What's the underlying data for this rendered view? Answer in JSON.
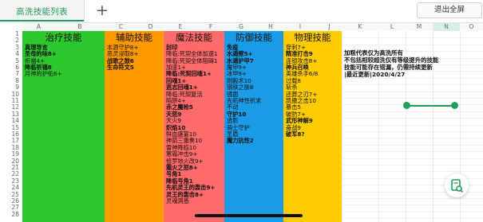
{
  "toolbar": {
    "tab_label": "高洗技能列表",
    "add_label": "+",
    "exit_label": "退出全屏"
  },
  "columns": [
    "A",
    "B",
    "C",
    "D",
    "E",
    "F",
    "G",
    "H",
    "I",
    "J",
    "K",
    "L",
    "M",
    "N",
    "O"
  ],
  "rows": [
    "1",
    "2",
    "3",
    "4",
    "5",
    "6",
    "7",
    "8",
    "9",
    "10",
    "11",
    "12",
    "13",
    "14",
    "15",
    "16",
    "17",
    "18",
    "19",
    "20",
    "21",
    "22",
    "23",
    "24",
    "25",
    "26",
    "27",
    "28"
  ],
  "categories": [
    {
      "title": "治疗技能",
      "color": "#2ec72e",
      "items": [
        {
          "t": "真理导言",
          "b": true
        },
        {
          "t": "圣母的味8+",
          "b": true
        },
        {
          "t": "祈福4+",
          "b": false
        },
        {
          "t": "降临祈福8",
          "b": true
        },
        {
          "t": "月神的护佑6+",
          "b": false
        }
      ]
    },
    {
      "title": "辅助技能",
      "color": "#ff9900",
      "items": [
        {
          "t": "本源守护8+",
          "b": false
        },
        {
          "t": "恶灵浸取8+",
          "b": false
        },
        {
          "t": "战歌之鼓6",
          "b": true
        },
        {
          "t": "生命符文5",
          "b": true
        }
      ]
    },
    {
      "title": "魔法技能",
      "color": "#ff6b6b",
      "items": [
        {
          "t": "封印",
          "b": true
        },
        {
          "t": "降临:死契全体加速1",
          "b": false
        },
        {
          "t": "降临:死契全体阻碍1",
          "b": false
        },
        {
          "t": "加速1+",
          "b": false
        },
        {
          "t": "降临:死契回魂1+",
          "b": true
        },
        {
          "t": "回魂1+",
          "b": true
        },
        {
          "t": "逃志回魂1+",
          "b": true
        },
        {
          "t": "降临:死契复活",
          "b": false
        },
        {
          "t": "陷阱4+",
          "b": false
        },
        {
          "t": "赤之魔枪5",
          "b": true
        },
        {
          "t": "天怒9",
          "b": true
        },
        {
          "t": "天火9",
          "b": false
        },
        {
          "t": "炽焰10",
          "b": true
        },
        {
          "t": "鲜血盛宴10",
          "b": false
        },
        {
          "t": "神箭三重奏10",
          "b": false
        },
        {
          "t": "雷神降临10",
          "b": false
        },
        {
          "t": "寒霜冲击9+",
          "b": false
        },
        {
          "t": "修罗地火改9+",
          "b": false
        },
        {
          "t": "霜火之怒8+",
          "b": true
        },
        {
          "t": "号角1",
          "b": true
        },
        {
          "t": "降临号角1",
          "b": true
        },
        {
          "t": "先机灵王的轰击9+",
          "b": true
        },
        {
          "t": "灵王的轰击8+",
          "b": true
        },
        {
          "t": "灵魂洞悉",
          "b": false
        }
      ]
    },
    {
      "title": "防御技能",
      "color": "#1a9be6",
      "items": [
        {
          "t": "免疫",
          "b": true
        },
        {
          "t": "水遁壁5+",
          "b": true
        },
        {
          "t": "水遁护甲7",
          "b": true
        },
        {
          "t": "魔甲9+",
          "b": false
        },
        {
          "t": "冰甲9+",
          "b": false
        },
        {
          "t": "刚毅术10",
          "b": false
        },
        {
          "t": "钢铁之肤8",
          "b": false
        },
        {
          "t": "镜面",
          "b": false
        },
        {
          "t": "先机神性祈求",
          "b": false
        },
        {
          "t": "不动",
          "b": false
        },
        {
          "t": "守护10",
          "b": true
        },
        {
          "t": "透影",
          "b": false
        },
        {
          "t": "骑士守护",
          "b": false
        },
        {
          "t": "圣盾",
          "b": false
        },
        {
          "t": "魔力抗性2",
          "b": true
        }
      ]
    },
    {
      "title": "物理技能",
      "color": "#ffcc00",
      "items": [
        {
          "t": "穿刺7+",
          "b": false
        },
        {
          "t": "精准打击9",
          "b": true
        },
        {
          "t": "连锁攻击8+",
          "b": false
        },
        {
          "t": "神兵召唤",
          "b": true
        },
        {
          "t": "英雄杀手6/8",
          "b": false
        },
        {
          "t": "过载8",
          "b": false
        },
        {
          "t": "斩杀",
          "b": false
        },
        {
          "t": "还葬之刃7+",
          "b": false
        },
        {
          "t": "凯撒之击10",
          "b": false
        },
        {
          "t": "暴击5",
          "b": false
        },
        {
          "t": "破防7+",
          "b": false
        },
        {
          "t": "武形神解9",
          "b": true
        },
        {
          "t": "奋战9",
          "b": false
        },
        {
          "t": "破军8?",
          "b": true
        }
      ]
    }
  ],
  "notes": [
    "加粗代表仅为高洗所有",
    "不包括相较超洗仅有等级提升的技能",
    "技能可能存在错漏，仍需持续更新",
    "|最近更新|2020/4/27"
  ]
}
